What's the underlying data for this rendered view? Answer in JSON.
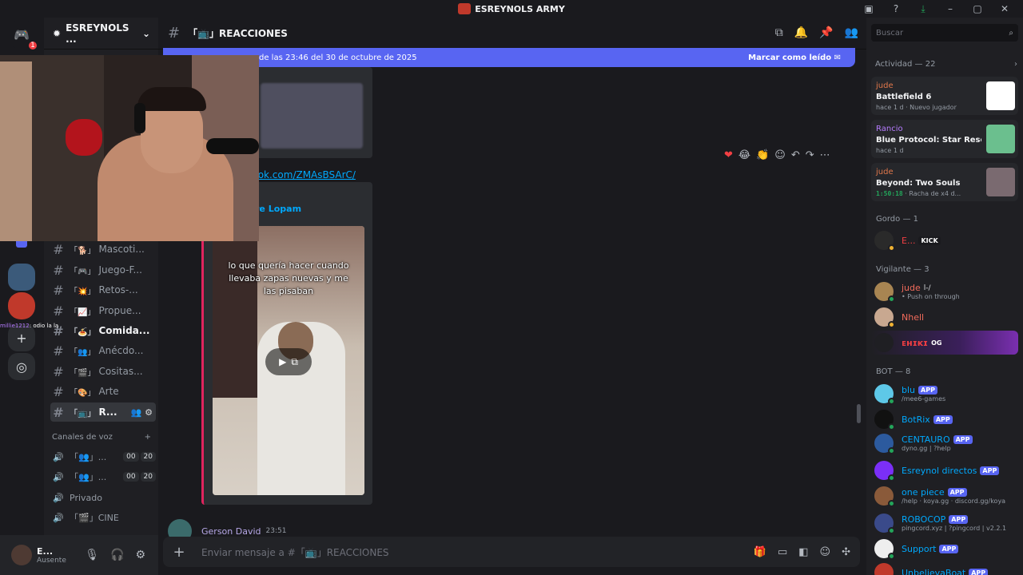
{
  "titlebar": {
    "title": "ESREYNOLS ARMY"
  },
  "server": {
    "name": "ESREYNOLS ...",
    "notification_count": "1"
  },
  "channels": [
    {
      "emoji": "「🐕」",
      "label": "Mascoti..."
    },
    {
      "emoji": "「🎮」",
      "label": "Juego-F..."
    },
    {
      "emoji": "「💥」",
      "label": "Retos-..."
    },
    {
      "emoji": "「📈」",
      "label": "Propue..."
    },
    {
      "emoji": "「🍝」",
      "label": "Comida..."
    },
    {
      "emoji": "「👥」",
      "label": "Anécdo..."
    },
    {
      "emoji": "「🎬」",
      "label": "Cositas..."
    },
    {
      "emoji": "「🎨」",
      "label": "Arte"
    },
    {
      "emoji": "「📺」",
      "label": "R..."
    }
  ],
  "voice_section": {
    "title": "Canales de voz"
  },
  "voice_channels": [
    {
      "label": "「👥」...",
      "count1": "00",
      "count2": "20"
    },
    {
      "label": "「👥」...",
      "count1": "00",
      "count2": "20"
    },
    {
      "label": "Privado",
      "count1": "",
      "count2": ""
    },
    {
      "label": "「🎬」CINE",
      "count1": "",
      "count2": ""
    }
  ],
  "user": {
    "name": "E...",
    "status": "Ausente"
  },
  "channel_header": {
    "name": "「📺」REACCIONES"
  },
  "banner": {
    "text": "de las 23:46 del 30 de octubre de 2025",
    "action": "Marcar como leído"
  },
  "message": {
    "link": "tok.com/ZMAsBSArC/",
    "embed_author": "re Lopam",
    "video_caption": "lo que quería hacer cuando llevaba zapas nuevas y me las pisaban"
  },
  "next_message": {
    "author": "Gerson David",
    "time": "23:51"
  },
  "composer": {
    "placeholder": "Enviar mensaje a #「📺」REACCIONES"
  },
  "stream_chat": {
    "user": "millie1212",
    "text": ": odio la la"
  },
  "search": {
    "placeholder": "Buscar"
  },
  "activity": {
    "title": "Actividad — 22",
    "cards": [
      {
        "user": "jude",
        "game": "Battlefield 6",
        "meta": "hace 1 d · Nuevo jugador",
        "timer": ""
      },
      {
        "user": "Rancio",
        "game": "Blue Protocol: Star Resona...",
        "meta": "hace 1 d",
        "timer": ""
      },
      {
        "user": "jude",
        "game": "Beyond: Two Souls",
        "meta": " · Racha de x4 d...",
        "timer": "1:50:18"
      }
    ]
  },
  "roles": {
    "gordo": "Gordo — 1",
    "vigilante": "Vigilante — 3",
    "bot": "BOT — 8"
  },
  "members": {
    "gordo": [
      {
        "name": "E...",
        "tag": "KICK",
        "color": "#f23f43"
      }
    ],
    "vigilante": [
      {
        "name": "jude",
        "tag": "l-/",
        "sub": "• Push on through",
        "color": "#f26b5b"
      },
      {
        "name": "Nhell",
        "tag": "",
        "sub": "",
        "color": "#f26b5b"
      },
      {
        "name": "ᴇʜɪᴋɪ",
        "tag": "OG",
        "sub": "",
        "color": "#f23f43"
      }
    ],
    "bots": [
      {
        "name": "blu",
        "sub": "/mee6-games",
        "color": "#00a8fc"
      },
      {
        "name": "BotRix",
        "sub": "",
        "color": "#00a8fc"
      },
      {
        "name": "CENTAURO",
        "sub": "dyno.gg | ?help",
        "color": "#00a8fc"
      },
      {
        "name": "Esreynol directos",
        "sub": "",
        "color": "#00a8fc"
      },
      {
        "name": "one piece",
        "sub": "/help · koya.gg · discord.gg/koya",
        "color": "#00a8fc"
      },
      {
        "name": "ROBOCOP",
        "sub": "pingcord.xyz | ?pingcord | v2.2.1",
        "color": "#00a8fc"
      },
      {
        "name": "Support",
        "sub": "",
        "color": "#00a8fc"
      },
      {
        "name": "UnbelievaBoat",
        "sub": "",
        "color": "#00a8fc"
      }
    ],
    "app_tag": "APP"
  }
}
